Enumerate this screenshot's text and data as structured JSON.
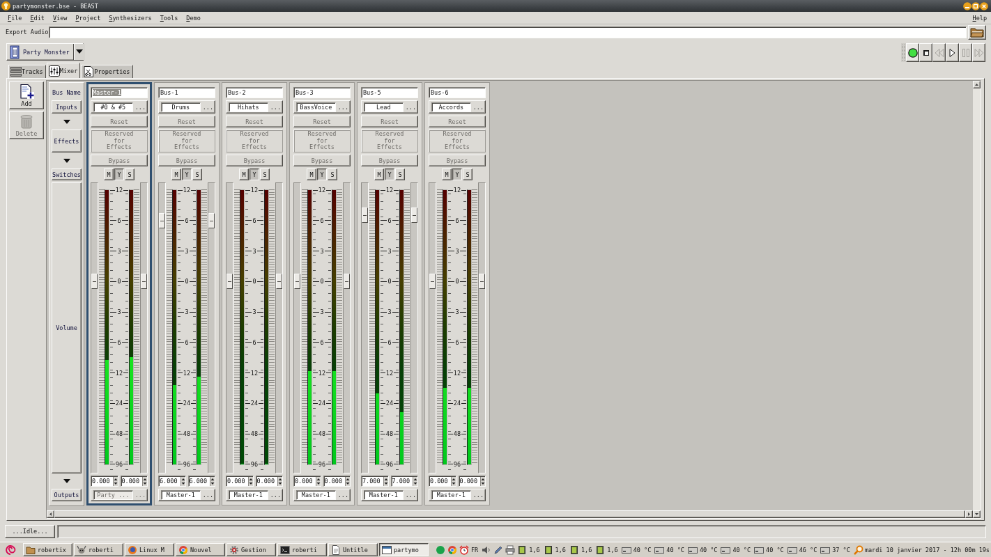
{
  "window": {
    "title": "partymonster.bse - BEAST"
  },
  "menu": {
    "items": [
      "File",
      "Edit",
      "View",
      "Project",
      "Synthesizers",
      "Tools",
      "Demo"
    ],
    "help": "Help"
  },
  "export": {
    "label": "Export Audio"
  },
  "project": {
    "name": "Party Monster"
  },
  "transport": [
    {
      "kind": "record",
      "disabled": false
    },
    {
      "kind": "stop",
      "disabled": false
    },
    {
      "kind": "rewind",
      "disabled": true
    },
    {
      "kind": "play",
      "disabled": false
    },
    {
      "kind": "pause",
      "disabled": true
    },
    {
      "kind": "forward",
      "disabled": true
    }
  ],
  "tabs": [
    {
      "label": "Tracks",
      "kind": "tracks",
      "selected": false
    },
    {
      "label": "Mixer",
      "kind": "mixer",
      "selected": true
    },
    {
      "label": "Properties",
      "kind": "properties",
      "selected": false
    }
  ],
  "toolbar": [
    {
      "label": "Add",
      "kind": "add",
      "disabled": false
    },
    {
      "label": "Delete",
      "kind": "delete",
      "disabled": true
    }
  ],
  "mixer": {
    "row_labels": [
      {
        "kind": "text",
        "label": "Bus Name"
      },
      {
        "kind": "button",
        "label": "Inputs"
      },
      {
        "kind": "arrow"
      },
      {
        "kind": "button",
        "label": "Effects"
      },
      {
        "kind": "arrow"
      },
      {
        "kind": "button",
        "label": "Switches"
      },
      {
        "kind": "panel",
        "label": "Volume"
      },
      {
        "kind": "arrow"
      },
      {
        "kind": "button",
        "label": "Outputs"
      }
    ],
    "strips": [
      {
        "name": "Master-1",
        "selected": true,
        "input": {
          "value": "#0 & #5",
          "more": "...",
          "disabled": false
        },
        "reset": {
          "label": "Reset",
          "disabled": true
        },
        "effects": {
          "label": "Reserved for Effects",
          "disabled": true
        },
        "bypass": {
          "label": "Bypass",
          "disabled": true
        },
        "switches": [
          {
            "label": "M",
            "on": false
          },
          {
            "label": "Y",
            "on": true
          },
          {
            "label": "S",
            "on": false
          }
        ],
        "faders": [
          {
            "level": 0.67
          },
          {
            "level": 0.67
          }
        ],
        "meters": [
          {
            "level": 0.38
          },
          {
            "level": 0.39
          }
        ],
        "scale": [
          "12",
          "6",
          "3",
          "0",
          "3",
          "6",
          "12",
          "24",
          "48",
          "96"
        ],
        "volumes": [
          "0.000",
          "0.000"
        ],
        "output": {
          "value": "Party ...",
          "more": "...",
          "disabled": true
        }
      },
      {
        "name": "Bus-1",
        "selected": false,
        "input": {
          "value": "Drums",
          "more": "...",
          "disabled": false
        },
        "reset": {
          "label": "Reset",
          "disabled": true
        },
        "effects": {
          "label": "Reserved for Effects",
          "disabled": true
        },
        "bypass": {
          "label": "Bypass",
          "disabled": true
        },
        "switches": [
          {
            "label": "M",
            "on": false
          },
          {
            "label": "Y",
            "on": true
          },
          {
            "label": "S",
            "on": false
          }
        ],
        "faders": [
          {
            "level": 0.89
          },
          {
            "level": 0.89
          }
        ],
        "meters": [
          {
            "level": 0.29
          },
          {
            "level": 0.32
          }
        ],
        "scale": [
          "12",
          "6",
          "3",
          "0",
          "3",
          "6",
          "12",
          "24",
          "48",
          "96"
        ],
        "volumes": [
          "6.000",
          "6.000"
        ],
        "output": {
          "value": "Master-1",
          "more": "...",
          "disabled": false
        }
      },
      {
        "name": "Bus-2",
        "selected": false,
        "input": {
          "value": "Hihats",
          "more": "...",
          "disabled": false
        },
        "reset": {
          "label": "Reset",
          "disabled": true
        },
        "effects": {
          "label": "Reserved for Effects",
          "disabled": true
        },
        "bypass": {
          "label": "Bypass",
          "disabled": true
        },
        "switches": [
          {
            "label": "M",
            "on": false
          },
          {
            "label": "Y",
            "on": true
          },
          {
            "label": "S",
            "on": false
          }
        ],
        "faders": [
          {
            "level": 0.67
          },
          {
            "level": 0.67
          }
        ],
        "meters": [
          {
            "level": 0
          },
          {
            "level": 0
          }
        ],
        "scale": [
          "12",
          "6",
          "3",
          "0",
          "3",
          "6",
          "12",
          "24",
          "48",
          "96"
        ],
        "volumes": [
          "0.000",
          "0.000"
        ],
        "output": {
          "value": "Master-1",
          "more": "...",
          "disabled": false
        }
      },
      {
        "name": "Bus-3",
        "selected": false,
        "input": {
          "value": "BassVoice",
          "more": "...",
          "disabled": false
        },
        "reset": {
          "label": "Reset",
          "disabled": true
        },
        "effects": {
          "label": "Reserved for Effects",
          "disabled": true
        },
        "bypass": {
          "label": "Bypass",
          "disabled": true
        },
        "switches": [
          {
            "label": "M",
            "on": false
          },
          {
            "label": "Y",
            "on": true
          },
          {
            "label": "S",
            "on": false
          }
        ],
        "faders": [
          {
            "level": 0.67
          },
          {
            "level": 0.67
          }
        ],
        "meters": [
          {
            "level": 0.34
          },
          {
            "level": 0.34
          }
        ],
        "scale": [
          "12",
          "6",
          "3",
          "0",
          "3",
          "6",
          "12",
          "24",
          "48",
          "96"
        ],
        "volumes": [
          "0.000",
          "0.000"
        ],
        "output": {
          "value": "Master-1",
          "more": "...",
          "disabled": false
        }
      },
      {
        "name": "Bus-5",
        "selected": false,
        "input": {
          "value": "Lead",
          "more": "...",
          "disabled": false
        },
        "reset": {
          "label": "Reset",
          "disabled": true
        },
        "effects": {
          "label": "Reserved for Effects",
          "disabled": true
        },
        "bypass": {
          "label": "Bypass",
          "disabled": true
        },
        "switches": [
          {
            "label": "M",
            "on": false
          },
          {
            "label": "Y",
            "on": true
          },
          {
            "label": "S",
            "on": false
          }
        ],
        "faders": [
          {
            "level": 0.91
          },
          {
            "level": 0.91
          }
        ],
        "meters": [
          {
            "level": 0.26
          },
          {
            "level": 0.19
          }
        ],
        "scale": [
          "12",
          "6",
          "3",
          "0",
          "3",
          "6",
          "12",
          "24",
          "48",
          "96"
        ],
        "volumes": [
          "7.000",
          "7.000"
        ],
        "output": {
          "value": "Master-1",
          "more": "...",
          "disabled": false
        }
      },
      {
        "name": "Bus-6",
        "selected": false,
        "input": {
          "value": "Accords",
          "more": "...",
          "disabled": false
        },
        "reset": {
          "label": "Reset",
          "disabled": true
        },
        "effects": {
          "label": "Reserved for Effects",
          "disabled": true
        },
        "bypass": {
          "label": "Bypass",
          "disabled": true
        },
        "switches": [
          {
            "label": "M",
            "on": false
          },
          {
            "label": "Y",
            "on": true
          },
          {
            "label": "S",
            "on": false
          }
        ],
        "faders": [
          {
            "level": 0.67
          },
          {
            "level": 0.67
          }
        ],
        "meters": [
          {
            "level": 0.28
          },
          {
            "level": 0.28
          }
        ],
        "scale": [
          "12",
          "6",
          "3",
          "0",
          "3",
          "6",
          "12",
          "24",
          "48",
          "96"
        ],
        "volumes": [
          "0.000",
          "0.000"
        ],
        "output": {
          "value": "Master-1",
          "more": "...",
          "disabled": false
        }
      }
    ]
  },
  "status_bar": {
    "text": "...Idle..."
  },
  "taskbar": {
    "tasks": [
      {
        "label": "robertix",
        "kind": "folder",
        "selected": false
      },
      {
        "label": "roberti",
        "kind": "animal",
        "selected": false
      },
      {
        "label": "Linux M",
        "kind": "globe",
        "selected": false
      },
      {
        "label": "Nouvel",
        "kind": "wheel",
        "selected": false
      },
      {
        "label": "Gestion",
        "kind": "gear",
        "selected": false
      },
      {
        "label": "roberti",
        "kind": "terminal",
        "selected": false
      },
      {
        "label": "Untitle",
        "kind": "document",
        "selected": false
      },
      {
        "label": "partymo",
        "kind": "window",
        "selected": true
      }
    ],
    "tray": [
      {
        "kind": "dot"
      },
      {
        "kind": "wheel"
      },
      {
        "kind": "alarm"
      },
      {
        "kind": "label",
        "text": "FR"
      },
      {
        "kind": "speaker"
      },
      {
        "kind": "pen"
      },
      {
        "kind": "printer"
      },
      {
        "kind": "cpu",
        "text": "1,6"
      },
      {
        "kind": "cpu",
        "text": "1,6"
      },
      {
        "kind": "cpu",
        "text": "1,6"
      },
      {
        "kind": "cpu",
        "text": "1,6"
      },
      {
        "kind": "temp",
        "text": "40 °C"
      },
      {
        "kind": "temp",
        "text": "40 °C"
      },
      {
        "kind": "temp",
        "text": "40 °C"
      },
      {
        "kind": "temp",
        "text": "40 °C"
      },
      {
        "kind": "temp",
        "text": "40 °C"
      },
      {
        "kind": "temp",
        "text": "46 °C"
      },
      {
        "kind": "temp",
        "text": "37 °C"
      },
      {
        "kind": "search"
      }
    ],
    "clock": "mardi 10 janvier 2017 - 12h 00m 19s"
  }
}
